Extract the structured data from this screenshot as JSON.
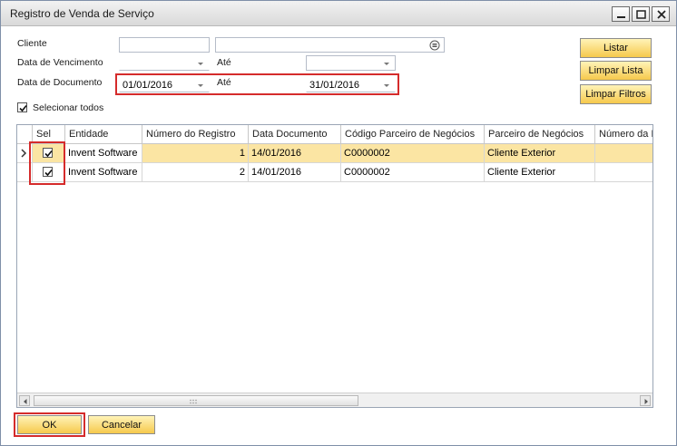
{
  "window": {
    "title": "Registro de Venda de Serviço"
  },
  "filters": {
    "cliente_label": "Cliente",
    "cliente_code": "",
    "cliente_name": "",
    "venc_label": "Data de Vencimento",
    "venc_from": "",
    "venc_ate_label": "Até",
    "venc_to": "",
    "doc_label": "Data de Documento",
    "doc_from": "01/01/2016",
    "doc_ate_label": "Até",
    "doc_to": "31/01/2016",
    "select_all_label": "Selecionar todos",
    "select_all_checked": true
  },
  "side_buttons": {
    "listar": "Listar",
    "limpar_lista": "Limpar Lista",
    "limpar_filtros": "Limpar Filtros"
  },
  "grid": {
    "columns": [
      "Sel",
      "Entidade",
      "Número do Registro",
      "Data Documento",
      "Código Parceiro de Negócios",
      "Parceiro de Negócios",
      "Número da N"
    ],
    "rows": [
      {
        "sel": true,
        "entidade": "Invent Software",
        "numero": "1",
        "data": "14/01/2016",
        "codigo": "C0000002",
        "parceiro": "Cliente Exterior",
        "numero_n": ""
      },
      {
        "sel": true,
        "entidade": "Invent Software",
        "numero": "2",
        "data": "14/01/2016",
        "codigo": "C0000002",
        "parceiro": "Cliente Exterior",
        "numero_n": ""
      }
    ]
  },
  "footer": {
    "ok": "OK",
    "cancel": "Cancelar"
  },
  "colors": {
    "highlight": "#d52b2b",
    "button": "#f6c94c",
    "selected_row": "#fbe5a3"
  }
}
